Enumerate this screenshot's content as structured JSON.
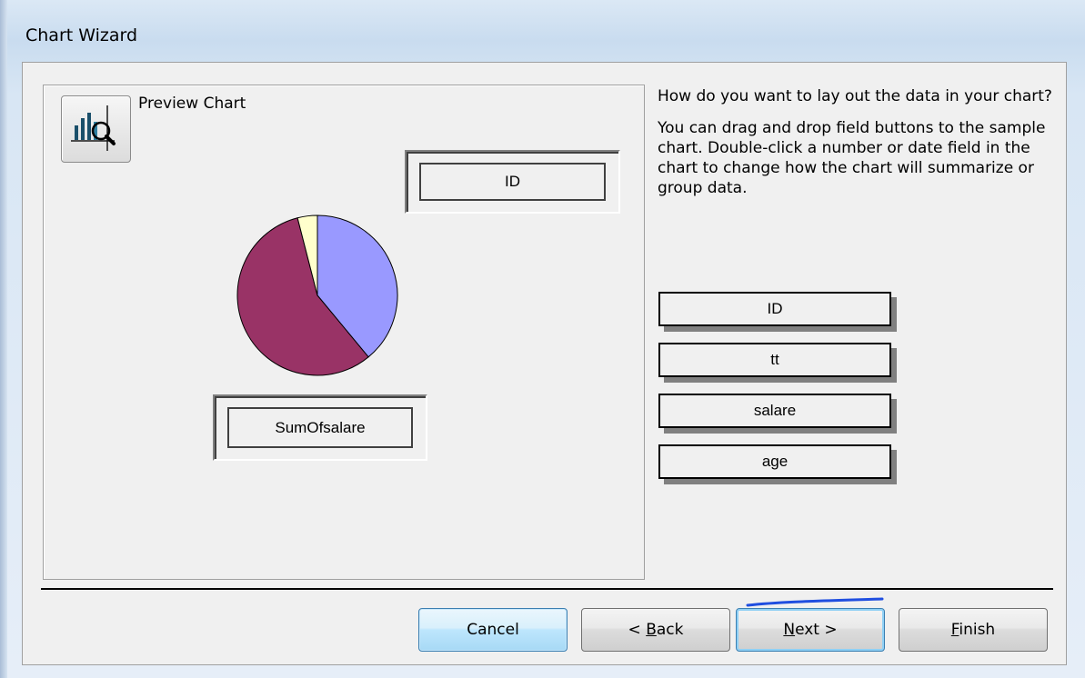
{
  "window": {
    "title": "Chart Wizard"
  },
  "preview": {
    "button_icon": "chart-magnifier-icon",
    "label": "Preview Chart",
    "series_field": "ID",
    "data_field": "SumOfsalare"
  },
  "chart_data": {
    "type": "pie",
    "slices": [
      {
        "color": "#9999ff",
        "share": 0.39
      },
      {
        "color": "#993366",
        "share": 0.57
      },
      {
        "color": "#ffffcc",
        "share": 0.04
      }
    ]
  },
  "instructions": {
    "question": "How do you want to lay out the data in your chart?",
    "help": "You can drag and drop field buttons to the sample chart. Double-click a number or date field in the chart to change how the chart will summarize or group data."
  },
  "fields": [
    "ID",
    "tt",
    "salare",
    "age"
  ],
  "buttons": {
    "cancel": "Cancel",
    "back_prefix": "< ",
    "back_key": "B",
    "back_rest": "ack",
    "next_key": "N",
    "next_rest": "ext >",
    "finish_key": "F",
    "finish_rest": "inish"
  },
  "colors": {
    "focus_blue": "#3c7fb1",
    "scribble_blue": "#1f4ee0"
  }
}
